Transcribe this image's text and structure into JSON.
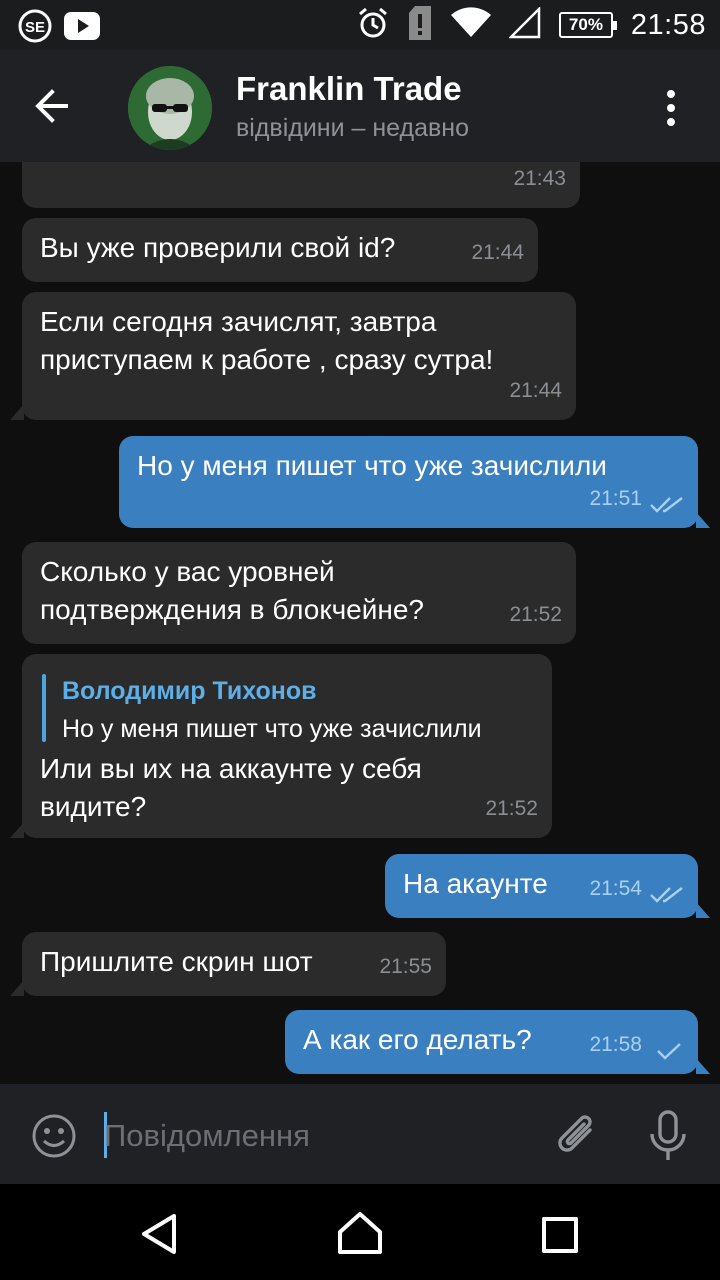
{
  "status_bar": {
    "left_icons": [
      "se-app-icon",
      "youtube-icon"
    ],
    "right_icons": [
      "alarm-icon",
      "sd-card-alert-icon",
      "wifi-icon",
      "signal-icon"
    ],
    "battery": "70%",
    "time": "21:58"
  },
  "header": {
    "title": "Franklin Trade",
    "status": "відвідини – недавно"
  },
  "messages": [
    {
      "dir": "in",
      "text": "",
      "time": "21:43"
    },
    {
      "dir": "in",
      "text": "Вы уже проверили свой id?",
      "time": "21:44"
    },
    {
      "dir": "in",
      "lines": [
        "Если сегодня зачислят, завтра",
        "приступаем к работе , сразу сутра!"
      ],
      "time": "21:44"
    },
    {
      "dir": "out",
      "text": "Но у меня пишет что уже зачислили",
      "time": "21:51",
      "status": "read"
    },
    {
      "dir": "in",
      "lines": [
        "Сколько у вас уровней",
        "подтверждения в блокчейне?"
      ],
      "time": "21:52"
    },
    {
      "dir": "in",
      "reply": {
        "name": "Володимир Тихонов",
        "text": "Но у меня пишет что уже зачислили"
      },
      "lines": [
        "Или вы их на аккаунте у себя",
        "видите?"
      ],
      "time": "21:52"
    },
    {
      "dir": "out",
      "text": "На акаунте",
      "time": "21:54",
      "status": "read"
    },
    {
      "dir": "in",
      "text": "Пришлите скрин шот",
      "time": "21:55"
    },
    {
      "dir": "out",
      "text": "А как его делать?",
      "time": "21:58",
      "status": "sent"
    }
  ],
  "composer": {
    "placeholder": "Повідомлення"
  },
  "colors": {
    "incoming_bubble": "#2b2b2b",
    "outgoing_bubble": "#3a7fbf",
    "accent": "#5eaee8"
  }
}
